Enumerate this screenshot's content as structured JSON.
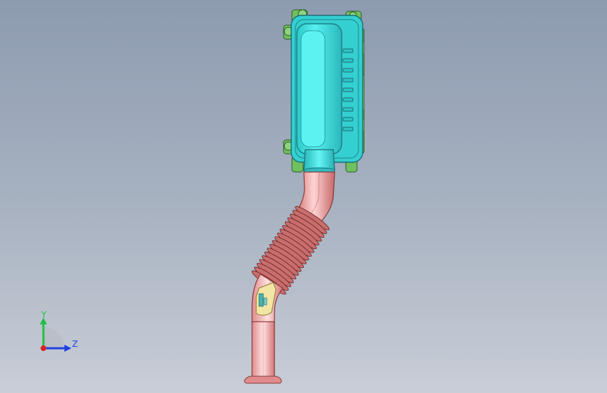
{
  "viewport": {
    "background_top": "#8d9bb0",
    "background_bottom": "#c9ced7"
  },
  "model": {
    "housing_color": "#3fe0e0",
    "housing_edge": "#1a6f74",
    "bracket_color": "#6fc060",
    "bracket_edge": "#2e5a25",
    "pipe_color": "#f0a0a0",
    "pipe_edge": "#8a3a3a",
    "bellows_color": "#c86d6d",
    "insert_color": "#f3e6a4"
  },
  "triad": {
    "x_color": "#e02020",
    "y_color": "#20c040",
    "z_color": "#2040e0",
    "y_label": "Y",
    "z_label": "Z"
  }
}
